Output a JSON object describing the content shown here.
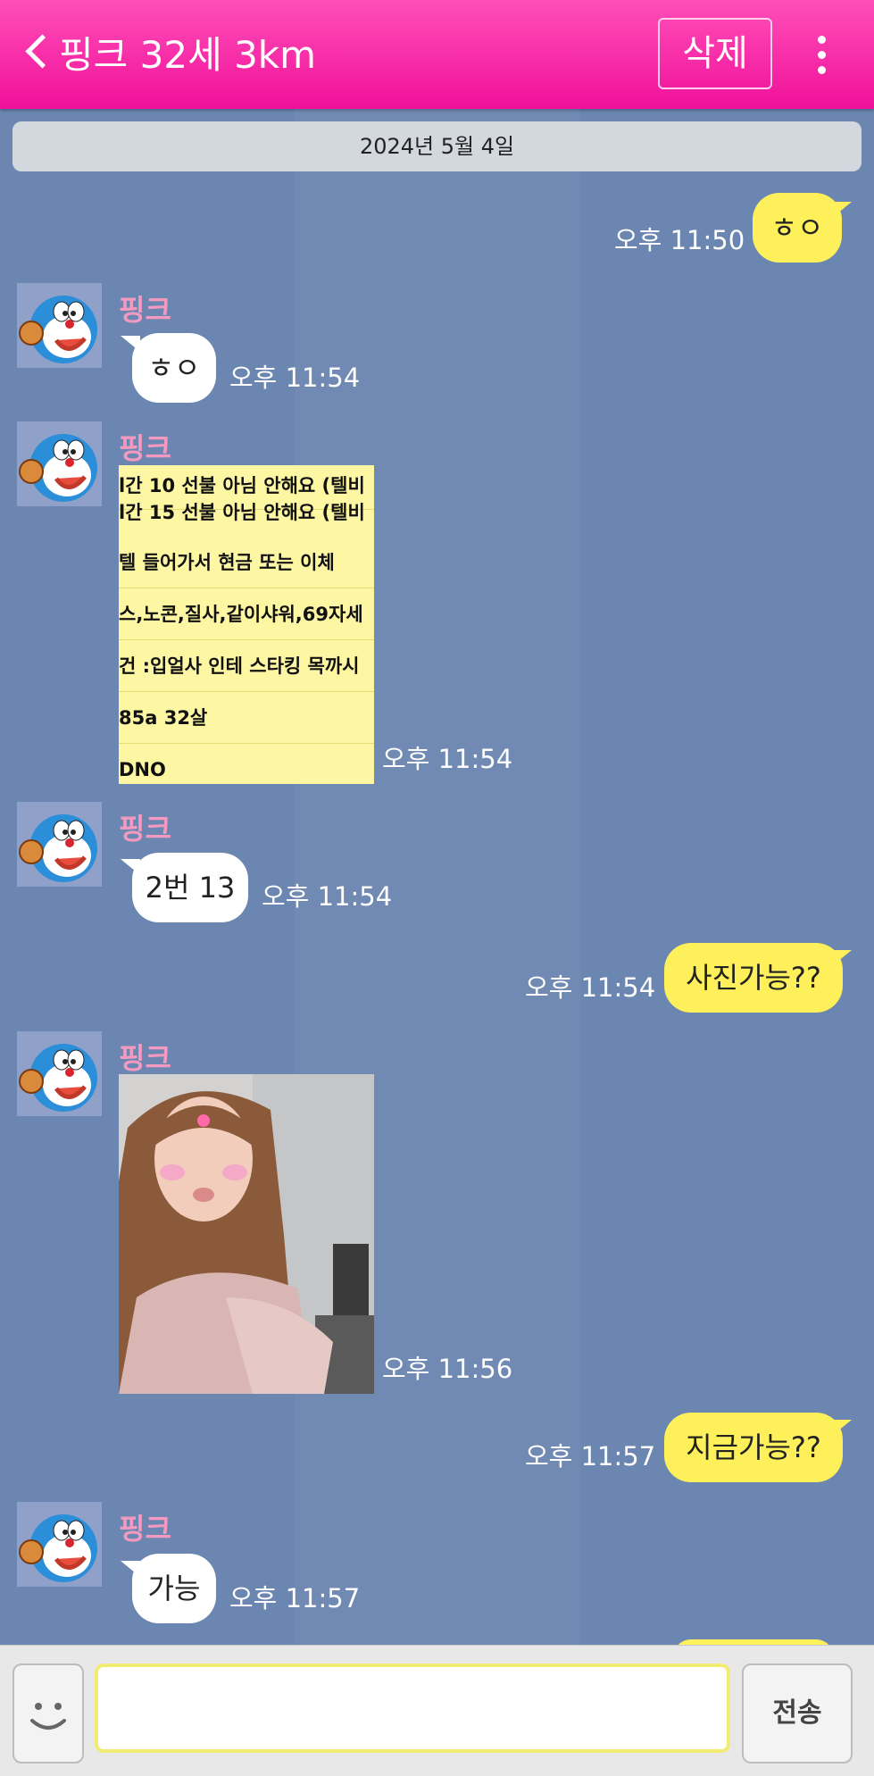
{
  "header": {
    "title": "핑크 32세 3km",
    "delete_label": "삭제",
    "back_icon": "chevron-left-icon",
    "more_icon": "more-vertical-icon"
  },
  "date_divider": "2024년 5월 4일",
  "contact_name": "핑크",
  "messages": [
    {
      "from": "me",
      "text": "ㅎㅇ",
      "time": "오후 11:50"
    },
    {
      "from": "other",
      "sender": "핑크",
      "text": "ㅎㅇ",
      "time": "오후 11:54"
    },
    {
      "from": "other",
      "sender": "핑크",
      "type": "image",
      "time": "오후 11:54",
      "image_text": [
        "l간 10 선불 아님 안해요 (텔비",
        "l간 15 선불 아님 안해요 (텔비",
        "텔 들어가서 현금 또는 이체",
        "스,노콘,질사,같이샤워,69자세",
        "건 :입얼사 인테 스타킹 목까시",
        "85a  32살",
        "DNO"
      ]
    },
    {
      "from": "other",
      "sender": "핑크",
      "text": "2번 13",
      "time": "오후 11:54"
    },
    {
      "from": "me",
      "text": "사진가능??",
      "time": "오후 11:54"
    },
    {
      "from": "other",
      "sender": "핑크",
      "type": "image",
      "time": "오후 11:56"
    },
    {
      "from": "me",
      "text": "지금가능??",
      "time": "오후 11:57"
    },
    {
      "from": "other",
      "sender": "핑크",
      "text": "가능",
      "time": "오후 11:57"
    }
  ],
  "composer": {
    "placeholder": "",
    "send_label": "전송",
    "emoji_icon": "smiley-icon"
  },
  "colors": {
    "header": "#f0109a",
    "chat_background": "#6b86b1",
    "my_bubble": "#fdf05a",
    "other_bubble": "#ffffff",
    "sender_name": "#f49ac1"
  }
}
